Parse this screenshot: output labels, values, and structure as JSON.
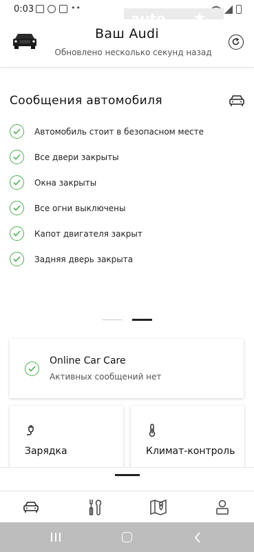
{
  "statusbar": {
    "time": "0:03"
  },
  "header": {
    "title": "Ваш Audi",
    "subtitle": "Обновлено несколько секунд назад"
  },
  "messages": {
    "title": "Сообщения автомобиля",
    "items": [
      {
        "label": "Автомобиль стоит в безопасном месте"
      },
      {
        "label": "Все двери закрыты"
      },
      {
        "label": "Окна закрыты"
      },
      {
        "label": "Все огни выключены"
      },
      {
        "label": "Капот двигателя закрыт"
      },
      {
        "label": "Задняя дверь закрыта"
      }
    ]
  },
  "pager": {
    "pages": 2,
    "active": 2
  },
  "care": {
    "title": "Online Car Care",
    "subtitle": "Активных сообщений нет"
  },
  "tiles": {
    "charge": "Зарядка",
    "climate": "Климат-контроль"
  },
  "colors": {
    "check": "#4caf50",
    "accent": "#222222",
    "sysnav": "#bdbdbd"
  },
  "icons": {
    "header": [
      "car-thumbnail-icon",
      "refresh-icon"
    ],
    "nav": [
      "car-icon",
      "tools-icon",
      "map-icon",
      "profile-icon"
    ]
  }
}
